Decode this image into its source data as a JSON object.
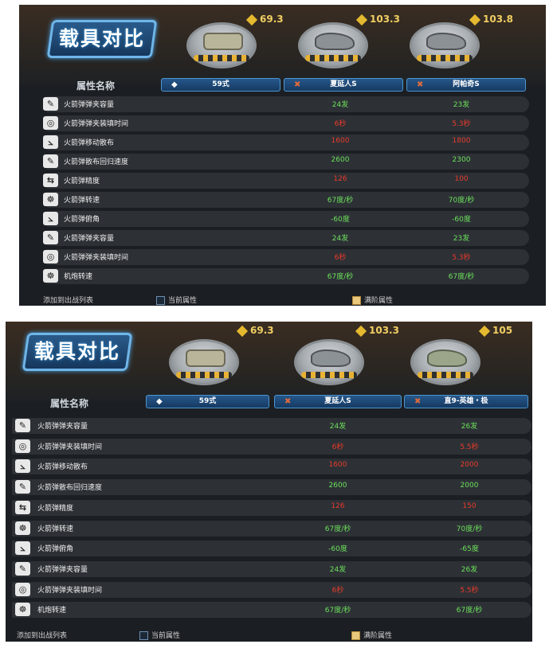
{
  "panel1": {
    "title": "载具对比",
    "attr_header": "属性名称",
    "vehicles": [
      {
        "name": "59式",
        "rank": "69.3",
        "marker": "◆"
      },
      {
        "name": "夏延人S",
        "rank": "103.3",
        "marker": "✖"
      },
      {
        "name": "阿帕奇S",
        "rank": "103.8",
        "marker": "✖"
      }
    ],
    "rows": [
      {
        "icon": "wrench-icon",
        "glyph": "✎",
        "label": "火箭弹弹夹容量",
        "v1": "24发",
        "v2": "23发",
        "c": "g"
      },
      {
        "icon": "gauge-icon",
        "glyph": "◎",
        "label": "火箭弹弹夹装填时间",
        "v1": "6秒",
        "v2": "5.3秒",
        "c": "r"
      },
      {
        "icon": "spread-icon",
        "glyph": "⦣",
        "label": "火箭弹移动散布",
        "v1": "1600",
        "v2": "1800",
        "c": "r"
      },
      {
        "icon": "recover-icon",
        "glyph": "✎",
        "label": "火箭弹散布回归速度",
        "v1": "2600",
        "v2": "2300",
        "c": "g"
      },
      {
        "icon": "precision-icon",
        "glyph": "⇆",
        "label": "火箭弹精度",
        "v1": "126",
        "v2": "100",
        "c": "r"
      },
      {
        "icon": "rotate-icon",
        "glyph": "☸",
        "label": "火箭弹转速",
        "v1": "67度/秒",
        "v2": "70度/秒",
        "c": "g"
      },
      {
        "icon": "depression-icon",
        "glyph": "⦣",
        "label": "火箭弹俯角",
        "v1": "-60度",
        "v2": "-60度",
        "c": "g"
      },
      {
        "icon": "wrench-icon",
        "glyph": "✎",
        "label": "火箭弹弹夹容量",
        "v1": "24发",
        "v2": "23发",
        "c": "g"
      },
      {
        "icon": "gauge-icon",
        "glyph": "◎",
        "label": "火箭弹弹夹装填时间",
        "v1": "6秒",
        "v2": "5.3秒",
        "c": "r"
      },
      {
        "icon": "rotate-icon",
        "glyph": "☸",
        "label": "机炮转速",
        "v1": "67度/秒",
        "v2": "67度/秒",
        "c": "g"
      }
    ],
    "footer": {
      "current": "当前属性",
      "max": "满阶属性",
      "add": "添加到出战列表"
    }
  },
  "panel2": {
    "title": "载具对比",
    "attr_header": "属性名称",
    "vehicles": [
      {
        "name": "59式",
        "rank": "69.3",
        "marker": "◆"
      },
      {
        "name": "夏延人S",
        "rank": "103.3",
        "marker": "✖"
      },
      {
        "name": "直9-英雄・极",
        "rank": "105",
        "marker": "✖"
      }
    ],
    "rows": [
      {
        "icon": "wrench-icon",
        "glyph": "✎",
        "label": "火箭弹弹夹容量",
        "v1": "24发",
        "v2": "26发",
        "c": "g"
      },
      {
        "icon": "gauge-icon",
        "glyph": "◎",
        "label": "火箭弹弹夹装填时间",
        "v1": "6秒",
        "v2": "5.5秒",
        "c": "r"
      },
      {
        "icon": "spread-icon",
        "glyph": "⦣",
        "label": "火箭弹移动散布",
        "v1": "1600",
        "v2": "2000",
        "c": "r"
      },
      {
        "icon": "recover-icon",
        "glyph": "✎",
        "label": "火箭弹散布回归速度",
        "v1": "2600",
        "v2": "2000",
        "c": "g"
      },
      {
        "icon": "precision-icon",
        "glyph": "⇆",
        "label": "火箭弹精度",
        "v1": "126",
        "v2": "150",
        "c": "r"
      },
      {
        "icon": "rotate-icon",
        "glyph": "☸",
        "label": "火箭弹转速",
        "v1": "67度/秒",
        "v2": "70度/秒",
        "c": "g"
      },
      {
        "icon": "depression-icon",
        "glyph": "⦣",
        "label": "火箭弹俯角",
        "v1": "-60度",
        "v2": "-65度",
        "c": "g"
      },
      {
        "icon": "wrench-icon",
        "glyph": "✎",
        "label": "火箭弹弹夹容量",
        "v1": "24发",
        "v2": "26发",
        "c": "g"
      },
      {
        "icon": "gauge-icon",
        "glyph": "◎",
        "label": "火箭弹弹夹装填时间",
        "v1": "6秒",
        "v2": "5.5秒",
        "c": "r"
      },
      {
        "icon": "rotate-icon",
        "glyph": "☸",
        "label": "机炮转速",
        "v1": "67度/秒",
        "v2": "67度/秒",
        "c": "g"
      }
    ],
    "footer": {
      "current": "当前属性",
      "max": "满阶属性",
      "add": "添加到出战列表"
    }
  }
}
